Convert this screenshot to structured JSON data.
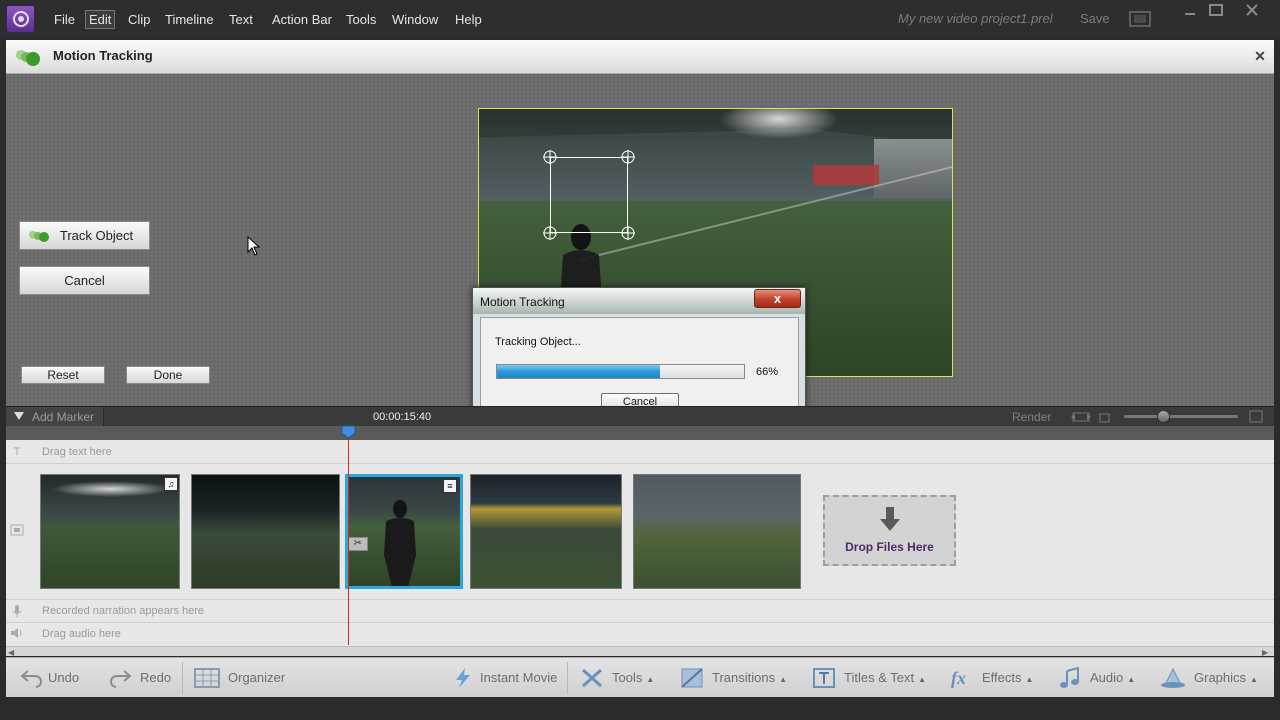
{
  "menubar": {
    "items": [
      "File",
      "Edit",
      "Clip",
      "Timeline",
      "Text",
      "Action Bar",
      "Tools",
      "Window",
      "Help"
    ],
    "active": "Edit",
    "project_name": "My new video project1.prel",
    "save_label": "Save"
  },
  "panel": {
    "title": "Motion Tracking",
    "track_object_label": "Track Object",
    "cancel_label": "Cancel",
    "reset_label": "Reset",
    "done_label": "Done"
  },
  "dialog": {
    "title": "Motion Tracking",
    "close_glyph": "x",
    "status": "Tracking Object...",
    "progress_percent": 66,
    "progress_text": "66%",
    "cancel_label": "Cancel"
  },
  "timeline_bar": {
    "add_marker_label": "Add Marker",
    "timecode": "00:00:15:40",
    "render_label": "Render"
  },
  "timeline": {
    "text_track": "Drag text here",
    "narration_track": "Recorded narration appears here",
    "audio_track": "Drag audio here",
    "drop_label": "Drop Files Here"
  },
  "actionbar": {
    "undo": "Undo",
    "redo": "Redo",
    "organizer": "Organizer",
    "instant_movie": "Instant Movie",
    "tools": "Tools",
    "transitions": "Transitions",
    "titles_text": "Titles & Text",
    "effects": "Effects",
    "audio": "Audio",
    "graphics": "Graphics"
  },
  "colors": {
    "accent_blue": "#2ba7e0",
    "playhead_red": "#dd2222",
    "preview_border": "#d7e64b",
    "progress_fill": "#2c9ad8"
  }
}
